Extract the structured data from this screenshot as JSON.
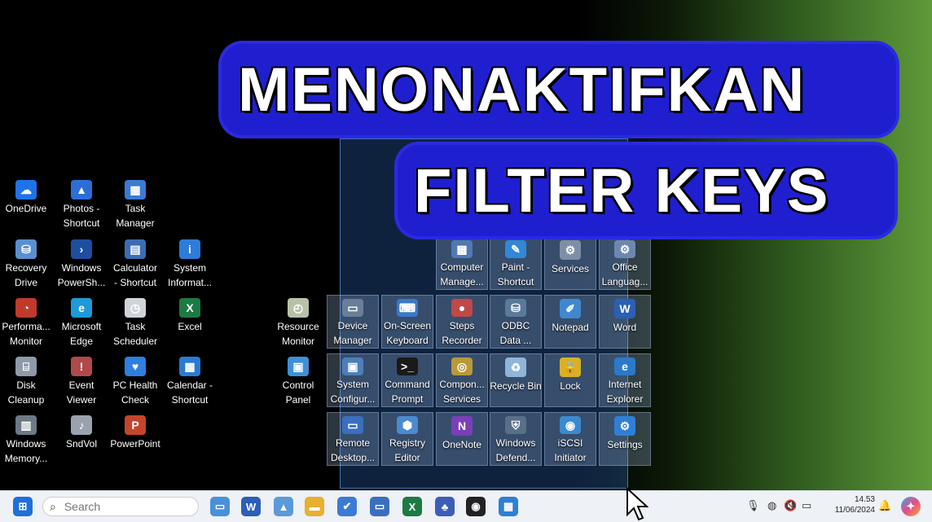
{
  "banner": {
    "line1": "MENONAKTIFKAN",
    "line2": "FILTER  KEYS"
  },
  "colors": {
    "banner_bg": "#1f1fd0",
    "selection": "#285aa0",
    "taskbar_bg": "#eef1f5"
  },
  "desktop_icons": [
    {
      "label": "OneDrive",
      "icon": "onedrive-icon",
      "color": "#1e73e8",
      "glyph": "☁"
    },
    {
      "label": "Photos -\nShortcut",
      "icon": "photos-icon",
      "color": "#2b6fd6",
      "glyph": "▲"
    },
    {
      "label": "Task\nManager",
      "icon": "task-manager-icon",
      "color": "#3a7bd5",
      "glyph": "▦"
    },
    {
      "label": "Recovery\nDrive",
      "icon": "recovery-drive-icon",
      "color": "#5a8fd0",
      "glyph": "⛁"
    },
    {
      "label": "Windows\nPowerSh...",
      "icon": "powershell-icon",
      "color": "#1f4e9e",
      "glyph": "›"
    },
    {
      "label": "Calculator\n- Shortcut",
      "icon": "calculator-icon",
      "color": "#3b6db5",
      "glyph": "▤"
    },
    {
      "label": "System\nInformat...",
      "icon": "system-info-icon",
      "color": "#2f7bd8",
      "glyph": "i"
    },
    {
      "label": "Performa...\nMonitor",
      "icon": "performance-monitor-icon",
      "color": "#c0392b",
      "glyph": "◔"
    },
    {
      "label": "Microsoft\nEdge",
      "icon": "edge-icon",
      "color": "#1c9bd8",
      "glyph": "e"
    },
    {
      "label": "Task\nScheduler",
      "icon": "task-scheduler-icon",
      "color": "#d0d4da",
      "glyph": "◷"
    },
    {
      "label": "Excel",
      "icon": "excel-icon",
      "color": "#1d7a45",
      "glyph": "X"
    },
    {
      "label": "Resource\nMonitor",
      "icon": "resource-monitor-icon",
      "color": "#b8c2a8",
      "glyph": "◴"
    },
    {
      "label": "Disk\nCleanup",
      "icon": "disk-cleanup-icon",
      "color": "#8f9aa8",
      "glyph": "⌸"
    },
    {
      "label": "Event\nViewer",
      "icon": "event-viewer-icon",
      "color": "#b04a4a",
      "glyph": "!"
    },
    {
      "label": "PC Health\nCheck",
      "icon": "pc-health-icon",
      "color": "#2d7fe0",
      "glyph": "♥"
    },
    {
      "label": "Calendar -\nShortcut",
      "icon": "calendar-icon",
      "color": "#2a7ad4",
      "glyph": "▦"
    },
    {
      "label": "Control\nPanel",
      "icon": "control-panel-icon",
      "color": "#3f8fd8",
      "glyph": "▣"
    },
    {
      "label": "Windows\nMemory...",
      "icon": "memory-diagnostic-icon",
      "color": "#6c7a86",
      "glyph": "▥"
    },
    {
      "label": "SndVol",
      "icon": "sndvol-icon",
      "color": "#9aa3ad",
      "glyph": "♪"
    },
    {
      "label": "PowerPoint",
      "icon": "powerpoint-icon",
      "color": "#c4452b",
      "glyph": "P"
    }
  ],
  "selected_icons": [
    {
      "label": "Computer\nManage...",
      "icon": "computer-management-icon",
      "color": "#4f78b8",
      "glyph": "▩"
    },
    {
      "label": "Paint -\nShortcut",
      "icon": "paint-icon",
      "color": "#2f88d8",
      "glyph": "✎"
    },
    {
      "label": "Services",
      "icon": "services-icon",
      "color": "#7d8fa6",
      "glyph": "⚙"
    },
    {
      "label": "Office\nLanguag...",
      "icon": "office-language-icon",
      "color": "#6d88b0",
      "glyph": "⚙"
    },
    {
      "label": "Device\nManager",
      "icon": "device-manager-icon",
      "color": "#6a7e98",
      "glyph": "▭"
    },
    {
      "label": "On-Screen\nKeyboard",
      "icon": "onscreen-keyboard-icon",
      "color": "#3b78c8",
      "glyph": "⌨"
    },
    {
      "label": "Steps\nRecorder",
      "icon": "steps-recorder-icon",
      "color": "#c04848",
      "glyph": "●"
    },
    {
      "label": "ODBC\nData ...",
      "icon": "odbc-icon",
      "color": "#5a7a9a",
      "glyph": "⛁"
    },
    {
      "label": "Notepad",
      "icon": "notepad-icon",
      "color": "#3f88d0",
      "glyph": "✐"
    },
    {
      "label": "Word",
      "icon": "word-icon",
      "color": "#2b5fb8",
      "glyph": "W"
    },
    {
      "label": "System\nConfigur...",
      "icon": "system-config-icon",
      "color": "#4d7fb8",
      "glyph": "▣"
    },
    {
      "label": "Command\nPrompt",
      "icon": "command-prompt-icon",
      "color": "#1a1a1a",
      "glyph": ">_"
    },
    {
      "label": "Compon...\nServices",
      "icon": "component-services-icon",
      "color": "#b89a3a",
      "glyph": "◎"
    },
    {
      "label": "Recycle Bin",
      "icon": "recycle-bin-icon",
      "color": "#8fb5d8",
      "glyph": "♻"
    },
    {
      "label": "Lock",
      "icon": "lock-icon",
      "color": "#d8b02a",
      "glyph": "🔒"
    },
    {
      "label": "Internet\nExplorer",
      "icon": "internet-explorer-icon",
      "color": "#2c79c8",
      "glyph": "e"
    },
    {
      "label": "Remote\nDesktop...",
      "icon": "remote-desktop-icon",
      "color": "#3a6fc0",
      "glyph": "▭"
    },
    {
      "label": "Registry\nEditor",
      "icon": "registry-editor-icon",
      "color": "#4a8ad0",
      "glyph": "⬢"
    },
    {
      "label": "OneNote",
      "icon": "onenote-icon",
      "color": "#7b3fb8",
      "glyph": "N"
    },
    {
      "label": "Windows\nDefend...",
      "icon": "windows-defender-icon",
      "color": "#5a6f88",
      "glyph": "⛨"
    },
    {
      "label": "iSCSI\nInitiator",
      "icon": "iscsi-icon",
      "color": "#3b8ad0",
      "glyph": "◉"
    },
    {
      "label": "Settings",
      "icon": "settings-icon",
      "color": "#2f7fd8",
      "glyph": "⚙"
    }
  ],
  "taskbar": {
    "search_placeholder": "Search",
    "apps": [
      {
        "icon": "start-icon",
        "color": "#1e6fd9",
        "glyph": "⊞"
      },
      {
        "icon": "display-icon",
        "color": "#4a90d9",
        "glyph": "▭"
      },
      {
        "icon": "word-icon",
        "color": "#2b5fb8",
        "glyph": "W"
      },
      {
        "icon": "photos-icon",
        "color": "#5a9ad8",
        "glyph": "▲"
      },
      {
        "icon": "file-explorer-icon",
        "color": "#e8b030",
        "glyph": "▬"
      },
      {
        "icon": "todo-icon",
        "color": "#3a7bd5",
        "glyph": "✔"
      },
      {
        "icon": "remote-desktop-icon",
        "color": "#3a6fc0",
        "glyph": "▭"
      },
      {
        "icon": "excel-icon",
        "color": "#1d7a45",
        "glyph": "X"
      },
      {
        "icon": "teams-icon",
        "color": "#3b5fb8",
        "glyph": "♣"
      },
      {
        "icon": "obs-icon",
        "color": "#222222",
        "glyph": "◉"
      },
      {
        "icon": "store-icon",
        "color": "#2d7fd8",
        "glyph": "▦"
      }
    ],
    "tray": {
      "mic_icon": "microphone-icon",
      "network_icon": "globe-icon",
      "volume_icon": "volume-muted-icon",
      "battery_icon": "battery-icon"
    },
    "time": "14.53",
    "date": "11/06/2024"
  }
}
